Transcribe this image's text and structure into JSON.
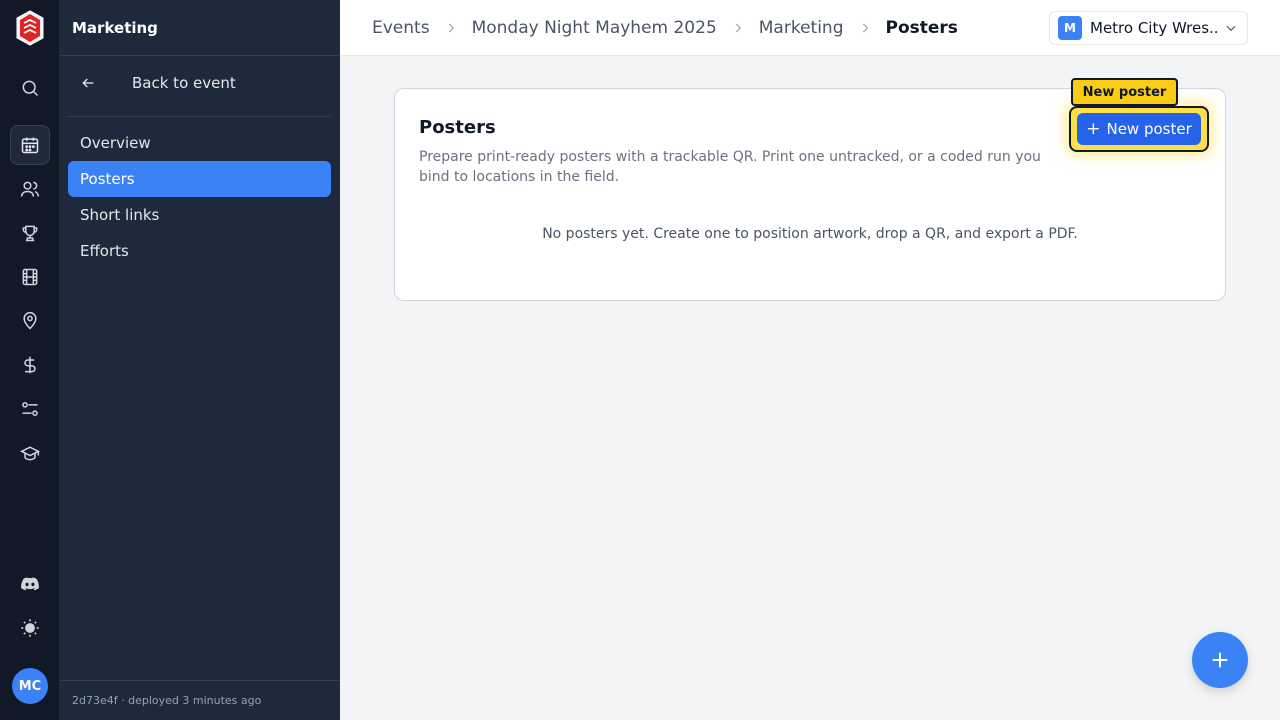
{
  "rail": {
    "items": [
      {
        "icon": "search-icon"
      },
      {
        "icon": "calendar-icon",
        "active": true
      },
      {
        "icon": "users-icon"
      },
      {
        "icon": "trophy-icon"
      },
      {
        "icon": "film-icon"
      },
      {
        "icon": "map-pin-icon"
      },
      {
        "icon": "dollar-icon"
      },
      {
        "icon": "sliders-icon"
      },
      {
        "icon": "graduation-cap-icon"
      },
      {
        "icon": "discord-icon"
      },
      {
        "icon": "sun-icon"
      }
    ],
    "avatar_initials": "MC"
  },
  "sidebar": {
    "title": "Marketing",
    "back_label": "Back to event",
    "items": [
      {
        "label": "Overview",
        "active": false
      },
      {
        "label": "Posters",
        "active": true
      },
      {
        "label": "Short links",
        "active": false
      },
      {
        "label": "Efforts",
        "active": false
      }
    ],
    "footer": "2d73e4f · deployed 3 minutes ago"
  },
  "header": {
    "breadcrumbs": [
      "Events",
      "Monday Night Mayhem 2025",
      "Marketing",
      "Posters"
    ],
    "org": {
      "badge": "M",
      "name": "Metro City Wres..."
    }
  },
  "main": {
    "title": "Posters",
    "description": "Prepare print-ready posters with a trackable QR. Print one untracked, or a coded run you bind to locations in the field.",
    "empty_state": "No posters yet. Create one to position artwork, drop a QR, and export a PDF.",
    "new_button": "New poster",
    "tooltip": "New poster"
  },
  "colors": {
    "accent": "#3b82f6",
    "highlight": "#facc15",
    "sidebar_bg": "#1e293b",
    "rail_bg": "#111827"
  }
}
